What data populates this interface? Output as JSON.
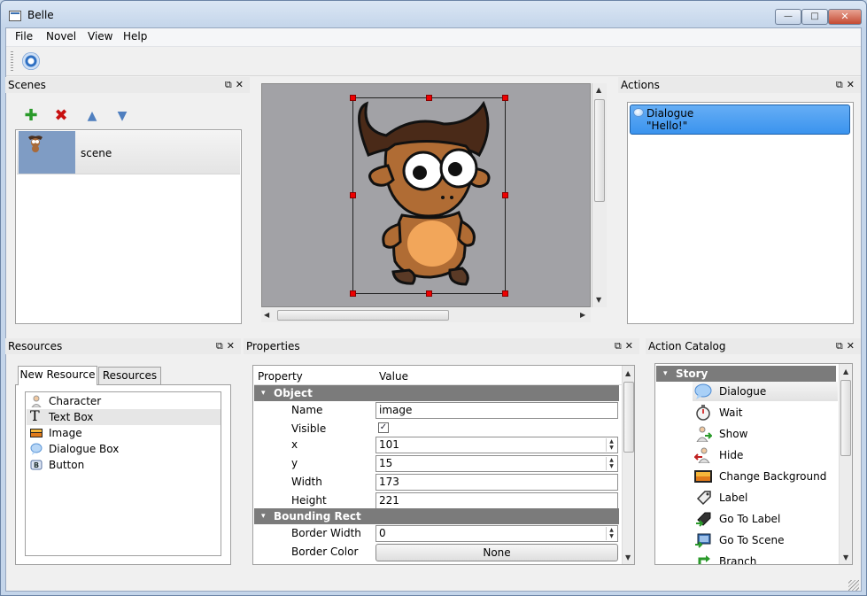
{
  "window": {
    "title": "Belle"
  },
  "menu": [
    "File",
    "Novel",
    "View",
    "Help"
  ],
  "scenes_panel": {
    "title": "Scenes",
    "items": [
      {
        "label": "scene"
      }
    ]
  },
  "actions_panel": {
    "title": "Actions",
    "items": [
      {
        "title": "Dialogue",
        "text": "\"Hello!\""
      }
    ]
  },
  "resources_panel": {
    "title": "Resources",
    "tabs": [
      "New Resource",
      "Resources"
    ],
    "active_tab": 0,
    "items": [
      {
        "label": "Character",
        "icon": "character-icon"
      },
      {
        "label": "Text Box",
        "icon": "text-box-icon"
      },
      {
        "label": "Image",
        "icon": "image-icon"
      },
      {
        "label": "Dialogue Box",
        "icon": "dialogue-box-icon"
      },
      {
        "label": "Button",
        "icon": "button-icon"
      }
    ],
    "selected": 1
  },
  "properties_panel": {
    "title": "Properties",
    "headers": {
      "property": "Property",
      "value": "Value"
    },
    "groups": [
      {
        "name": "Object",
        "rows": [
          {
            "label": "Name",
            "value": "image",
            "kind": "text"
          },
          {
            "label": "Visible",
            "value": "checked",
            "kind": "checkbox"
          },
          {
            "label": "x",
            "value": "101",
            "kind": "spin"
          },
          {
            "label": "y",
            "value": "15",
            "kind": "spin"
          },
          {
            "label": "Width",
            "value": "173",
            "kind": "text"
          },
          {
            "label": "Height",
            "value": "221",
            "kind": "text"
          }
        ]
      },
      {
        "name": "Bounding Rect",
        "rows": [
          {
            "label": "Border Width",
            "value": "0",
            "kind": "spin"
          },
          {
            "label": "Border Color",
            "value": "None",
            "kind": "button"
          }
        ]
      }
    ]
  },
  "catalog_panel": {
    "title": "Action Catalog",
    "category": "Story",
    "items": [
      {
        "label": "Dialogue",
        "icon": "speech-bubble-icon"
      },
      {
        "label": "Wait",
        "icon": "stopwatch-icon"
      },
      {
        "label": "Show",
        "icon": "show-character-icon"
      },
      {
        "label": "Hide",
        "icon": "hide-character-icon"
      },
      {
        "label": "Change Background",
        "icon": "background-icon"
      },
      {
        "label": "Label",
        "icon": "label-tag-icon"
      },
      {
        "label": "Go To Label",
        "icon": "goto-label-icon"
      },
      {
        "label": "Go To Scene",
        "icon": "goto-scene-icon"
      },
      {
        "label": "Branch",
        "icon": "branch-icon"
      }
    ],
    "selected": 0
  },
  "colors": {
    "selection_blue": "#3a93ee",
    "canvas_gray": "#a2a2a6",
    "handle_red": "#e00000",
    "group_gray": "#7b7b7b"
  }
}
